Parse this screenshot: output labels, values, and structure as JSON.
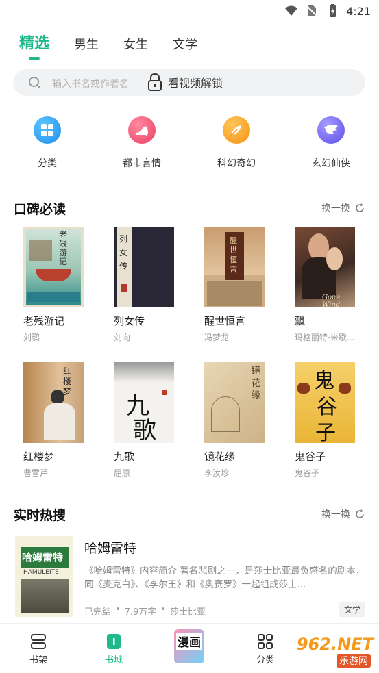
{
  "status": {
    "time": "4:21"
  },
  "tabs": [
    {
      "label": "精选",
      "active": true
    },
    {
      "label": "男生",
      "active": false
    },
    {
      "label": "女生",
      "active": false
    },
    {
      "label": "文学",
      "active": false
    }
  ],
  "search": {
    "placeholder": "输入书名或作者名",
    "unlock_label": "看视频解锁"
  },
  "categories": [
    {
      "label": "分类",
      "icon": "grid-icon",
      "color": "#2a9df4"
    },
    {
      "label": "都市言情",
      "icon": "high-heel-icon",
      "color": "#f0506e"
    },
    {
      "label": "科幻奇幻",
      "icon": "feather-icon",
      "color": "#f7a21b"
    },
    {
      "label": "玄幻仙侠",
      "icon": "wing-icon",
      "color": "#7367f0"
    }
  ],
  "section1": {
    "title": "口碑必读",
    "refresh_label": "换一换"
  },
  "books": [
    {
      "title": "老残游记",
      "author": "刘鹗"
    },
    {
      "title": "列女传",
      "author": "刘向"
    },
    {
      "title": "醒世恒言",
      "author": "冯梦龙"
    },
    {
      "title": "飘",
      "author": "玛格丽特·米歇..."
    },
    {
      "title": "红楼梦",
      "author": "曹雪芹"
    },
    {
      "title": "九歌",
      "author": "屈原"
    },
    {
      "title": "镜花缘",
      "author": "李汝珍"
    },
    {
      "title": "鬼谷子",
      "author": "鬼谷子"
    }
  ],
  "covers": {
    "c1": "老残游记",
    "c2": "列女传",
    "c3": "醒世恒言",
    "c4_en": "Gone Wind",
    "c5": "红楼梦",
    "c6a": "九",
    "c6b": "歌",
    "c7": "镜花缘",
    "c8a": "鬼",
    "c8b": "谷",
    "c8c": "子"
  },
  "section2": {
    "title": "实时热搜",
    "refresh_label": "换一换"
  },
  "hot": {
    "title": "哈姆雷特",
    "cover_cn": "哈姆雷特",
    "cover_en": "HAMULEITE",
    "description": "《哈姆雷特》内容简介 著名悲剧之一，是莎士比亚最负盛名的剧本，同《麦克白》、《李尔王》和《奥赛罗》一起组成莎士...",
    "status": "已完结",
    "words": "7.9万字",
    "author": "莎士比亚",
    "tag": "文学"
  },
  "bottom_nav": [
    {
      "label": "书架",
      "icon": "bookshelf-icon"
    },
    {
      "label": "书城",
      "icon": "bookstore-icon",
      "active": true
    },
    {
      "label": "漫画",
      "icon": "manga-icon"
    },
    {
      "label": "分类",
      "icon": "category-icon"
    }
  ],
  "watermark": {
    "text": "962.NET",
    "sub": "乐游网"
  }
}
